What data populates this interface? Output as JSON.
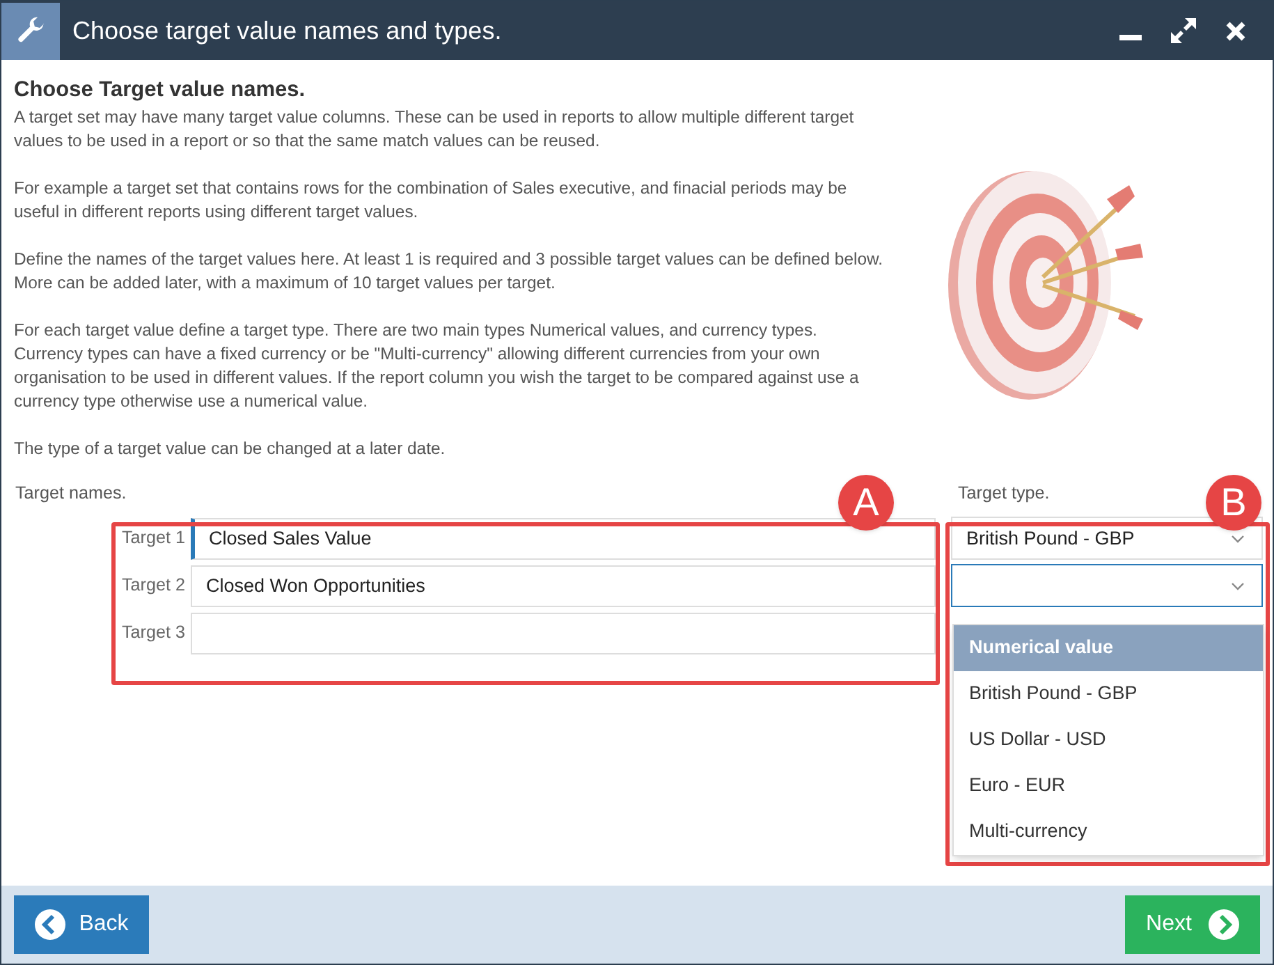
{
  "window": {
    "title": "Choose target value names and types."
  },
  "heading": "Choose Target value names.",
  "paragraphs": [
    "A target set may have many target value columns. These can be used in reports to allow multiple different target values to be used in a report or so that the same match values can be reused.",
    "For example a target set that contains rows for the combination of Sales executive, and finacial periods may be useful in different reports using different target values.",
    "Define the names of the target values here. At least 1 is required and 3 possible target values can be defined below. More can be added later, with a maximum of 10 target values per target.",
    "For each target value define a target type. There are two main types Numerical values, and currency types. Currency types can have a fixed currency or be \"Multi-currency\" allowing different currencies from your own organisation to be used in different values. If the report column you wish the target to be compared against use a currency type otherwise use a numerical value.",
    "The type of a target value can be changed at a later date."
  ],
  "target_names_label": "Target names.",
  "target_type_label": "Target type.",
  "targets": [
    {
      "label": "Target 1",
      "value": "Closed Sales Value",
      "focused": true,
      "type": "British Pound - GBP",
      "open": false
    },
    {
      "label": "Target 2",
      "value": "Closed Won Opportunities",
      "focused": false,
      "open": true
    }
  ],
  "target_3": {
    "label": "Target 3"
  },
  "dropdown_options": [
    {
      "label": "Numerical value",
      "selected": true
    },
    {
      "label": "British Pound - GBP",
      "selected": false
    },
    {
      "label": "US Dollar - USD",
      "selected": false
    },
    {
      "label": "Euro - EUR",
      "selected": false
    },
    {
      "label": "Multi-currency",
      "selected": false
    }
  ],
  "annotations": [
    {
      "label": "A"
    },
    {
      "label": "B"
    }
  ],
  "buttons": [
    {
      "label": "Back",
      "kind": "back"
    },
    {
      "label": "Next",
      "kind": "next"
    }
  ]
}
